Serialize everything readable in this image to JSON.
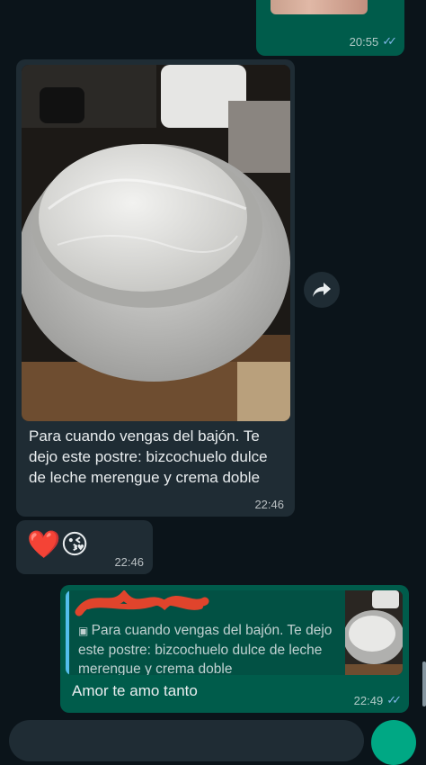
{
  "messages": {
    "top_outgoing": {
      "time": "20:55"
    },
    "image_message": {
      "caption": "Para cuando vengas del bajón. Te dejo este postre: bizcochuelo dulce de leche merengue y crema doble",
      "time": "22:46"
    },
    "emoji_message": {
      "emoji": "❤️😘",
      "time": "22:46"
    },
    "reply_message": {
      "quoted_text": "Para cuando vengas del bajón. Te dejo este postre: bizcochuelo dulce de leche merengue y crema doble",
      "text": "Amor te amo tanto",
      "time": "22:49"
    }
  },
  "icons": {
    "forward": "forward-icon",
    "read_receipt": "double-check-icon",
    "photo_indicator": "camera-icon"
  },
  "colors": {
    "background": "#0b141a",
    "incoming_bubble": "#1f2c34",
    "outgoing_bubble": "#005c4b",
    "read_ticks": "#53bdeb",
    "scribble": "#e0442c"
  }
}
